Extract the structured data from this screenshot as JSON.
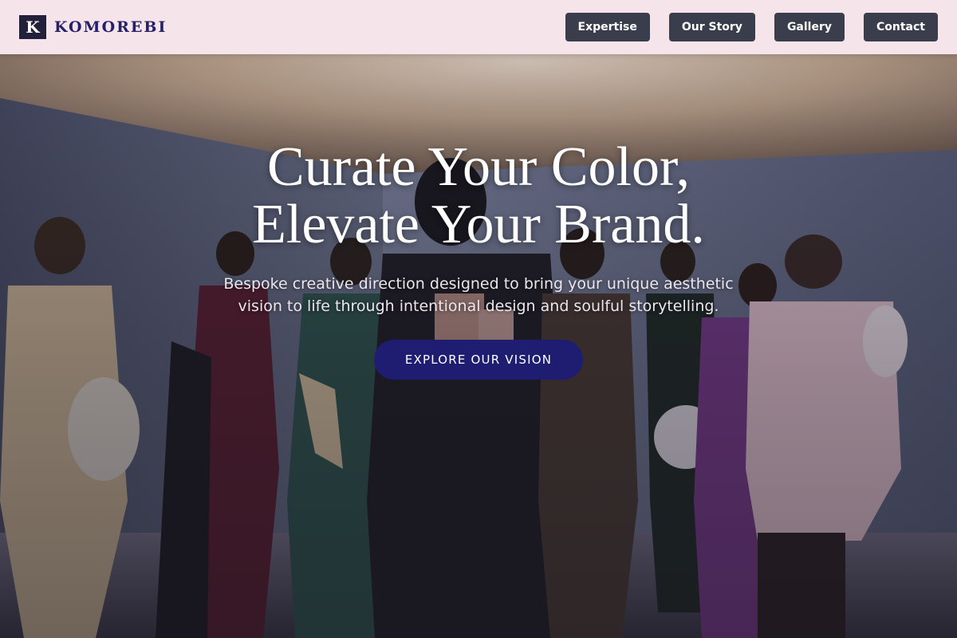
{
  "brand": {
    "mark": "K",
    "name": "KOMOREBI"
  },
  "nav": {
    "items": [
      {
        "label": "Expertise"
      },
      {
        "label": "Our Story"
      },
      {
        "label": "Gallery"
      },
      {
        "label": "Contact"
      }
    ]
  },
  "hero": {
    "title_line1": "Curate Your Color,",
    "title_line2": "Elevate Your Brand.",
    "subtitle": "Bespoke creative direction designed to bring your unique aesthetic vision to life through intentional design and soulful storytelling.",
    "cta_label": "EXPLORE OUR VISION"
  },
  "colors": {
    "nav_bg": "#f5e4ea",
    "nav_button": "#3a3d4c",
    "brand_text": "#24206a",
    "cta_bg": "#1e1d72"
  }
}
